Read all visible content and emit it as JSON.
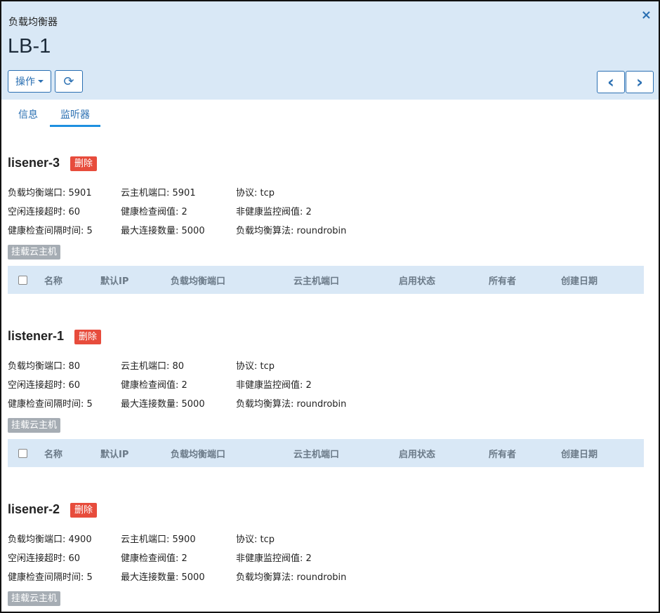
{
  "header": {
    "subtitle": "负载均衡器",
    "title": "LB-1",
    "close_icon": "×",
    "actions_label": "操作",
    "refresh_icon": "⟳",
    "prev_icon": "‹",
    "next_icon": "›"
  },
  "tabs": [
    {
      "label": "信息",
      "active": false
    },
    {
      "label": "监听器",
      "active": true
    }
  ],
  "table_headers": [
    "名称",
    "默认IP",
    "负载均衡端口",
    "云主机端口",
    "启用状态",
    "所有者",
    "创建日期"
  ],
  "listeners": [
    {
      "name": "lisener-3",
      "delete_label": "删除",
      "lb_port": "负载均衡端口:  5901",
      "vm_port": "云主机端口:  5901",
      "protocol": "协议:  tcp",
      "idle_timeout": "空闲连接超时:  60",
      "health_threshold": "健康检查阀值:  2",
      "unhealthy_threshold": "非健康监控阀值:  2",
      "health_interval": "健康检查间隔时间:  5",
      "max_conn": "最大连接数量:  5000",
      "algorithm": "负载均衡算法:  roundrobin",
      "attach_label": "挂载云主机"
    },
    {
      "name": "listener-1",
      "delete_label": "删除",
      "lb_port": "负载均衡端口:  80",
      "vm_port": "云主机端口:  80",
      "protocol": "协议:  tcp",
      "idle_timeout": "空闲连接超时:  60",
      "health_threshold": "健康检查阀值:  2",
      "unhealthy_threshold": "非健康监控阀值:  2",
      "health_interval": "健康检查间隔时间:  5",
      "max_conn": "最大连接数量:  5000",
      "algorithm": "负载均衡算法:  roundrobin",
      "attach_label": "挂载云主机"
    },
    {
      "name": "lisener-2",
      "delete_label": "删除",
      "lb_port": "负载均衡端口:  4900",
      "vm_port": "云主机端口:  5900",
      "protocol": "协议:  tcp",
      "idle_timeout": "空闲连接超时:  60",
      "health_threshold": "健康检查阀值:  2",
      "unhealthy_threshold": "非健康监控阀值:  2",
      "health_interval": "健康检查间隔时间:  5",
      "max_conn": "最大连接数量:  5000",
      "algorithm": "负载均衡算法:  roundrobin",
      "attach_label": "挂载云主机"
    }
  ],
  "colors": {
    "header_bg": "#d9e8f6",
    "accent": "#2a6fb2",
    "delete": "#e74c3c",
    "attach": "#a6adb4"
  }
}
